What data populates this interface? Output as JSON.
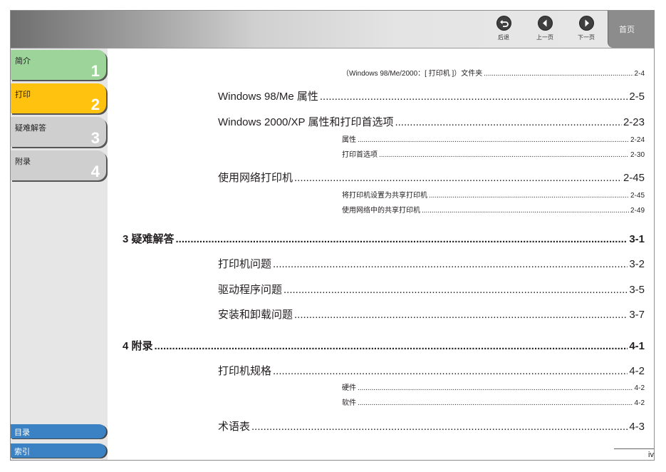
{
  "header": {
    "nav": {
      "back_label": "后退",
      "prev_label": "上一页",
      "next_label": "下一页"
    },
    "home_label": "首页"
  },
  "sidebar": {
    "tabs": [
      {
        "label": "简介",
        "number": "1",
        "color": "#9dd49a"
      },
      {
        "label": "打印",
        "number": "2",
        "color": "#ffc20e"
      },
      {
        "label": "疑难解答",
        "number": "3",
        "color": "#cfcfcf"
      },
      {
        "label": "附录",
        "number": "4",
        "color": "#cfcfcf"
      }
    ],
    "bottom": [
      {
        "label": "目录"
      },
      {
        "label": "索引"
      }
    ],
    "accent_blue": "#3a82c4"
  },
  "toc": {
    "entries": [
      {
        "level": 2,
        "title": "（Windows 98/Me/2000：[ 打印机 ]）文件夹",
        "page": "2-4"
      },
      {
        "level": 1,
        "title": "Windows 98/Me 属性",
        "page": "2-5"
      },
      {
        "level": 1,
        "title": "Windows 2000/XP 属性和打印首选项",
        "page": "2-23"
      },
      {
        "level": 2,
        "title": "属性",
        "page": "2-24"
      },
      {
        "level": 2,
        "title": "打印首选项",
        "page": "2-30"
      },
      {
        "level": 1,
        "title": "使用网络打印机",
        "page": "2-45"
      },
      {
        "level": 2,
        "title": "将打印机设置为共享打印机",
        "page": "2-45"
      },
      {
        "level": 2,
        "title": "使用网络中的共享打印机",
        "page": "2-49"
      },
      {
        "level": 0,
        "title": "3 疑难解答",
        "page": "3-1"
      },
      {
        "level": 1,
        "title": "打印机问题",
        "page": "3-2"
      },
      {
        "level": 1,
        "title": "驱动程序问题",
        "page": "3-5"
      },
      {
        "level": 1,
        "title": "安装和卸载问题",
        "page": "3-7"
      },
      {
        "level": 0,
        "title": "4 附录",
        "page": "4-1"
      },
      {
        "level": 1,
        "title": "打印机规格",
        "page": "4-2"
      },
      {
        "level": 2,
        "title": "硬件",
        "page": "4-2"
      },
      {
        "level": 2,
        "title": "软件",
        "page": "4-2"
      },
      {
        "level": 1,
        "title": "术语表",
        "page": "4-3"
      }
    ]
  },
  "footer": {
    "page_number": "iv"
  }
}
